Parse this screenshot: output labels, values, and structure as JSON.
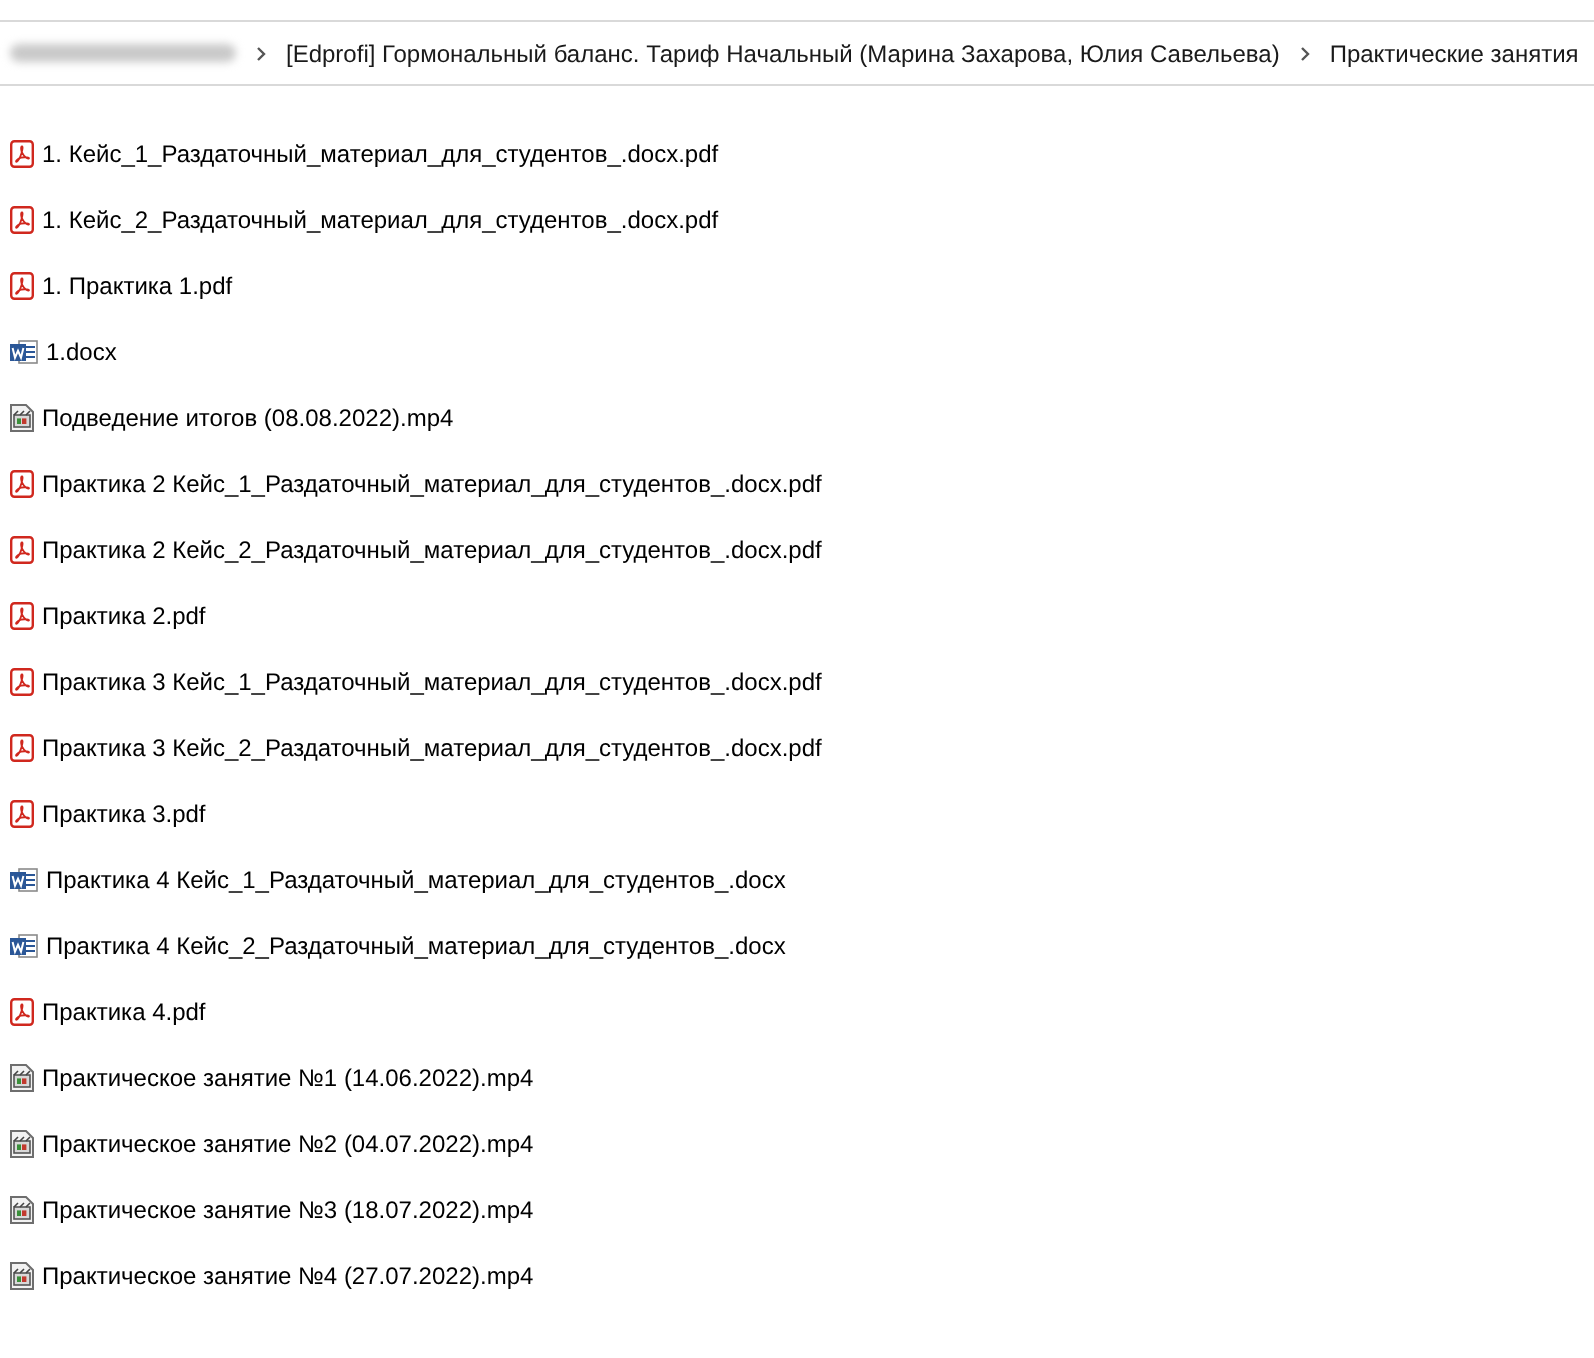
{
  "address_bar": {
    "breadcrumbs": [
      {
        "kind": "blurred"
      },
      {
        "kind": "folder",
        "label": "[Edprofi] Гормональный баланс. Тариф Начальный (Марина Захарова, Юлия Савельева)"
      },
      {
        "kind": "folder",
        "label": "Практические занятия"
      }
    ]
  },
  "files": [
    {
      "kind": "pdf",
      "name": "1. Кейс_1_Раздаточный_материал_для_студентов_.docx.pdf"
    },
    {
      "kind": "pdf",
      "name": "1. Кейс_2_Раздаточный_материал_для_студентов_.docx.pdf"
    },
    {
      "kind": "pdf",
      "name": "1. Практика 1.pdf"
    },
    {
      "kind": "docx",
      "name": "1.docx"
    },
    {
      "kind": "video",
      "name": "Подведение итогов (08.08.2022).mp4"
    },
    {
      "kind": "pdf",
      "name": "Практика 2 Кейс_1_Раздаточный_материал_для_студентов_.docx.pdf"
    },
    {
      "kind": "pdf",
      "name": "Практика 2 Кейс_2_Раздаточный_материал_для_студентов_.docx.pdf"
    },
    {
      "kind": "pdf",
      "name": "Практика 2.pdf"
    },
    {
      "kind": "pdf",
      "name": "Практика 3 Кейс_1_Раздаточный_материал_для_студентов_.docx.pdf"
    },
    {
      "kind": "pdf",
      "name": "Практика 3 Кейс_2_Раздаточный_материал_для_студентов_.docx.pdf"
    },
    {
      "kind": "pdf",
      "name": "Практика 3.pdf"
    },
    {
      "kind": "docx",
      "name": "Практика 4 Кейс_1_Раздаточный_материал_для_студентов_.docx"
    },
    {
      "kind": "docx",
      "name": "Практика 4 Кейс_2_Раздаточный_материал_для_студентов_.docx"
    },
    {
      "kind": "pdf",
      "name": "Практика 4.pdf"
    },
    {
      "kind": "video",
      "name": "Практическое занятие №1 (14.06.2022).mp4"
    },
    {
      "kind": "video",
      "name": "Практическое занятие №2 (04.07.2022).mp4"
    },
    {
      "kind": "video",
      "name": "Практическое занятие №3 (18.07.2022).mp4"
    },
    {
      "kind": "video",
      "name": "Практическое занятие №4 (27.07.2022).mp4"
    }
  ]
}
